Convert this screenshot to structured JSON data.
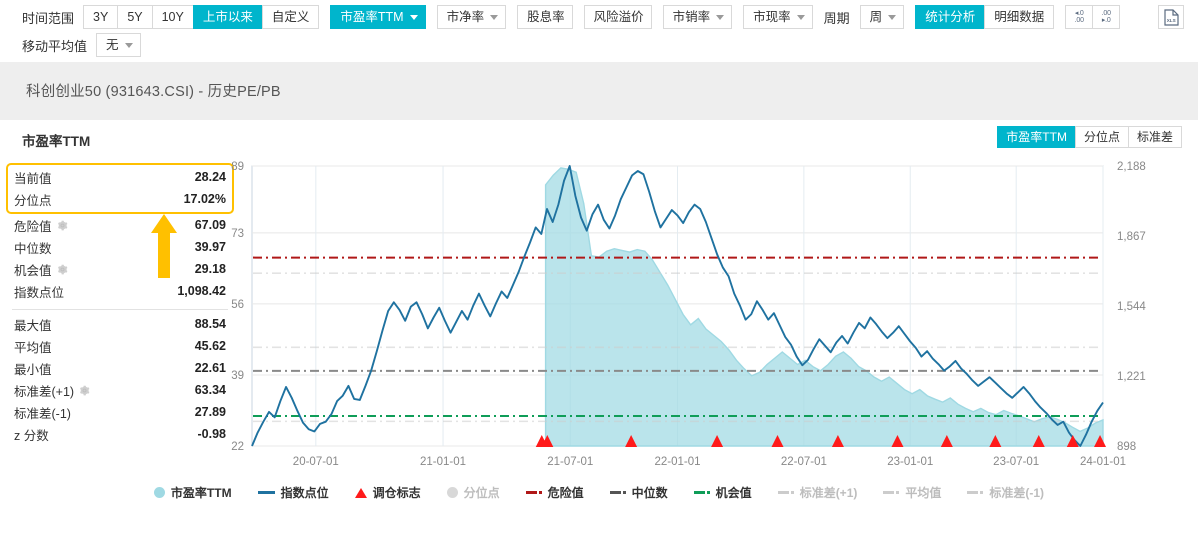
{
  "toolbar": {
    "time_range_label": "时间范围",
    "range_buttons": [
      {
        "label": "3Y",
        "active": false
      },
      {
        "label": "5Y",
        "active": false
      },
      {
        "label": "10Y",
        "active": false
      },
      {
        "label": "上市以来",
        "active": true
      },
      {
        "label": "自定义",
        "active": false
      }
    ],
    "metric_selects": [
      {
        "label": "市盈率TTM",
        "active": true,
        "caret": true
      },
      {
        "label": "市净率",
        "active": false,
        "caret": true
      },
      {
        "label": "股息率",
        "active": false,
        "caret": false
      },
      {
        "label": "风险溢价",
        "active": false,
        "caret": false
      },
      {
        "label": "市销率",
        "active": false,
        "caret": true
      },
      {
        "label": "市现率",
        "active": false,
        "caret": true
      }
    ],
    "period_label": "周期",
    "period_value": "周",
    "view_buttons": [
      {
        "label": "统计分析",
        "active": true
      },
      {
        "label": "明细数据",
        "active": false
      }
    ],
    "decimal_inc_icon": "decimal-increase-icon",
    "decimal_dec_icon": "decimal-decrease-icon",
    "export_icon": "xls-export-icon",
    "export_label": "XLS",
    "ma_label": "移动平均值",
    "ma_value": "无"
  },
  "header": {
    "chart_title": "科创创业50 (931643.CSI) - 历史PE/PB"
  },
  "card": {
    "metric_name": "市盈率TTM",
    "segmented": [
      {
        "label": "市盈率TTM",
        "active": true
      },
      {
        "label": "分位点",
        "active": false
      },
      {
        "label": "标准差",
        "active": false
      }
    ]
  },
  "stats": {
    "highlight_color": "#ffc000",
    "highlighted": [
      {
        "label": "当前值",
        "value": "28.24",
        "gear": false
      },
      {
        "label": "分位点",
        "value": "17.02%",
        "gear": false
      }
    ],
    "group_top": [
      {
        "label": "危险值",
        "value": "67.09",
        "gear": true
      },
      {
        "label": "中位数",
        "value": "39.97",
        "gear": false
      },
      {
        "label": "机会值",
        "value": "29.18",
        "gear": true
      },
      {
        "label": "指数点位",
        "value": "1,098.42",
        "gear": false
      }
    ],
    "group_bottom": [
      {
        "label": "最大值",
        "value": "88.54",
        "gear": false
      },
      {
        "label": "平均值",
        "value": "45.62",
        "gear": false
      },
      {
        "label": "最小值",
        "value": "22.61",
        "gear": false
      },
      {
        "label": "标准差(+1)",
        "value": "63.34",
        "gear": true
      },
      {
        "label": "标准差(-1)",
        "value": "27.89",
        "gear": false
      },
      {
        "label": "z 分数",
        "value": "-0.98",
        "gear": false
      }
    ]
  },
  "legend": [
    {
      "label": "市盈率TTM",
      "marker": "dot",
      "color": "#9fd9e3",
      "dim": false
    },
    {
      "label": "指数点位",
      "marker": "line",
      "color": "#1f72a0",
      "dim": false
    },
    {
      "label": "调仓标志",
      "marker": "triangle",
      "color": "#ff1a1a",
      "dim": false
    },
    {
      "label": "分位点",
      "marker": "dot",
      "color": "#d8d8d8",
      "dim": true
    },
    {
      "label": "危险值",
      "marker": "dashdot",
      "color": "#b01818",
      "dim": false
    },
    {
      "label": "中位数",
      "marker": "dashdot",
      "color": "#555555",
      "dim": false
    },
    {
      "label": "机会值",
      "marker": "dashdot",
      "color": "#0f9d58",
      "dim": false
    },
    {
      "label": "标准差(+1)",
      "marker": "dashdot",
      "color": "#cccccc",
      "dim": true
    },
    {
      "label": "平均值",
      "marker": "dashdot",
      "color": "#cccccc",
      "dim": true
    },
    {
      "label": "标准差(-1)",
      "marker": "dashdot",
      "color": "#cccccc",
      "dim": true
    }
  ],
  "chart_data": {
    "type": "line",
    "title": "市盈率TTM",
    "xlabel": "",
    "ylabel": "市盈率TTM",
    "y2label": "指数点位",
    "grid": true,
    "legend_position": "bottom",
    "x_ticks": [
      "20-07-01",
      "21-01-01",
      "21-07-01",
      "22-01-01",
      "22-07-01",
      "23-01-01",
      "23-07-01",
      "24-01-01"
    ],
    "x_tick_positions": [
      0.075,
      0.2245,
      0.374,
      0.5,
      0.6485,
      0.7735,
      0.898,
      1.0
    ],
    "y_ticks_left": [
      89,
      73,
      56,
      39,
      22
    ],
    "ylim": [
      22,
      89
    ],
    "y_ticks_right": [
      "2,188",
      "1,867",
      "1,544",
      "1,221",
      "898"
    ],
    "y2lim": [
      898,
      2188
    ],
    "reference_lines": [
      {
        "name": "危险值",
        "value": 67.09,
        "color": "#b01818",
        "style": "dashdot"
      },
      {
        "name": "中位数",
        "value": 39.97,
        "color": "#8a8a8a",
        "style": "dashdot"
      },
      {
        "name": "机会值",
        "value": 29.18,
        "color": "#0f9d58",
        "style": "dashdot"
      },
      {
        "name": "标准差(+1)",
        "value": 63.34,
        "color": "#cccccc",
        "style": "dashdot",
        "hidden": true
      },
      {
        "name": "平均值",
        "value": 45.62,
        "color": "#cccccc",
        "style": "dashdot",
        "hidden": true
      },
      {
        "name": "标准差(-1)",
        "value": 27.89,
        "color": "#cccccc",
        "style": "dashdot",
        "hidden": true
      }
    ],
    "series": [
      {
        "name": "指数点位",
        "type": "line",
        "color": "#1f72a0",
        "axis": "right",
        "values": [
          898,
          960,
          1010,
          1055,
          1030,
          1105,
          1170,
          1120,
          1060,
          1005,
          975,
          965,
          1000,
          1010,
          1045,
          1105,
          1130,
          1175,
          1115,
          1110,
          1175,
          1245,
          1335,
          1430,
          1520,
          1560,
          1525,
          1475,
          1540,
          1560,
          1505,
          1440,
          1490,
          1535,
          1475,
          1420,
          1470,
          1520,
          1480,
          1545,
          1600,
          1545,
          1495,
          1555,
          1610,
          1580,
          1640,
          1700,
          1770,
          1835,
          1905,
          1875,
          1990,
          1930,
          2010,
          2120,
          2188,
          2050,
          1950,
          1890,
          1965,
          2010,
          1940,
          1900,
          1960,
          2035,
          2090,
          2145,
          2165,
          2150,
          2070,
          1980,
          1905,
          1945,
          1985,
          1960,
          1925,
          1975,
          2010,
          1990,
          1930,
          1855,
          1780,
          1720,
          1680,
          1600,
          1545,
          1480,
          1505,
          1565,
          1525,
          1480,
          1510,
          1455,
          1400,
          1365,
          1310,
          1270,
          1295,
          1345,
          1390,
          1360,
          1330,
          1375,
          1405,
          1370,
          1420,
          1465,
          1440,
          1490,
          1460,
          1425,
          1395,
          1420,
          1450,
          1415,
          1380,
          1350,
          1310,
          1335,
          1300,
          1275,
          1245,
          1265,
          1290,
          1255,
          1230,
          1200,
          1175,
          1195,
          1215,
          1190,
          1165,
          1140,
          1120,
          1145,
          1170,
          1140,
          1105,
          1075,
          1050,
          1020,
          995,
          1010,
          960,
          925,
          898,
          950,
          1010,
          1060,
          1098.42
        ]
      },
      {
        "name": "市盈率TTM",
        "type": "area",
        "color": "#9fd9e3",
        "axis": "left",
        "start_fraction": 0.345,
        "values": [
          84.5,
          86.8,
          88.54,
          88.2,
          87.5,
          80.0,
          67.5,
          67.2,
          68.6,
          69.2,
          68.8,
          68.4,
          69.0,
          68.6,
          66.5,
          63.5,
          60.5,
          57.0,
          53.5,
          51.0,
          52.5,
          50.0,
          48.5,
          47.0,
          45.0,
          42.5,
          40.5,
          38.8,
          39.6,
          41.5,
          43.0,
          44.5,
          43.0,
          41.5,
          42.5,
          41.0,
          40.0,
          41.5,
          43.5,
          44.5,
          43.0,
          41.0,
          40.0,
          38.5,
          37.5,
          38.5,
          37.0,
          35.5,
          34.5,
          35.5,
          34.0,
          33.2,
          32.5,
          33.5,
          32.0,
          31.0,
          30.2,
          31.0,
          30.0,
          29.5,
          30.5,
          29.8,
          29.2,
          28.5,
          27.8,
          28.5,
          29.0,
          28.4,
          27.6,
          26.5,
          25.5,
          26.3,
          27.5,
          28.24
        ]
      }
    ],
    "rebalance_markers": {
      "name": "调仓标志",
      "color": "#ff1a1a",
      "positions": [
        0.3405,
        0.347,
        0.4455,
        0.5465,
        0.6175,
        0.6885,
        0.7585,
        0.8165,
        0.8735,
        0.9245,
        0.9645,
        0.9965
      ]
    }
  }
}
